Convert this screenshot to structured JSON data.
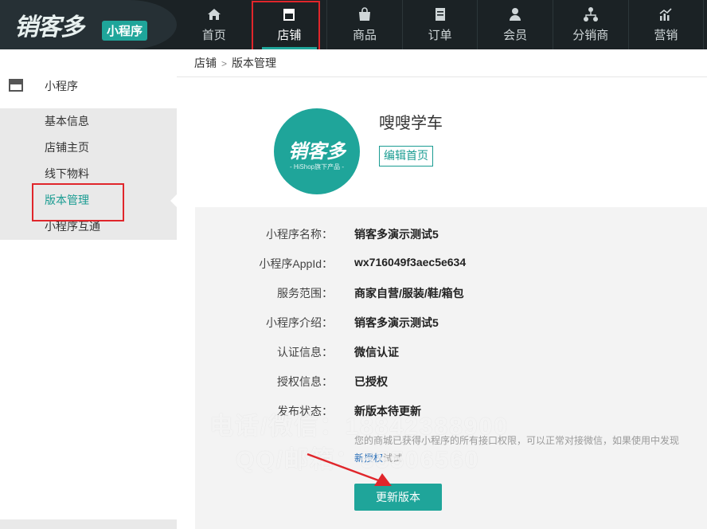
{
  "logo": {
    "main": "销客多",
    "badge": "小程序"
  },
  "nav": [
    {
      "label": "首页",
      "icon": "home-icon"
    },
    {
      "label": "店铺",
      "icon": "store-icon"
    },
    {
      "label": "商品",
      "icon": "bag-icon"
    },
    {
      "label": "订单",
      "icon": "order-icon"
    },
    {
      "label": "会员",
      "icon": "user-icon"
    },
    {
      "label": "分销商",
      "icon": "distributor-icon"
    },
    {
      "label": "营销",
      "icon": "chart-icon"
    }
  ],
  "sidebar": {
    "title": "小程序",
    "items": [
      {
        "label": "基本信息"
      },
      {
        "label": "店铺主页"
      },
      {
        "label": "线下物料"
      },
      {
        "label": "版本管理"
      },
      {
        "label": "小程序互通"
      }
    ]
  },
  "breadcrumb": {
    "root": "店铺",
    "current": "版本管理"
  },
  "shop": {
    "name": "嗖嗖学车",
    "edit_label": "编辑首页",
    "avatar_text": "销客多",
    "avatar_sub": "- HiShop旗下产品 -"
  },
  "info": [
    {
      "key": "小程序名称：",
      "value": "销客多演示测试5"
    },
    {
      "key": "小程序AppId：",
      "value": "wx716049f3aec5e634"
    },
    {
      "key": "服务范围：",
      "value": "商家自营/服装/鞋/箱包"
    },
    {
      "key": "小程序介绍：",
      "value": "销客多演示测试5"
    },
    {
      "key": "认证信息：",
      "value": "微信认证"
    },
    {
      "key": "授权信息：",
      "value": "已授权"
    },
    {
      "key": "发布状态：",
      "value": "新版本待更新"
    }
  ],
  "note": {
    "line1": "您的商城已获得小程序的所有接口权限，可以正常对接微信，如果使用中发现",
    "link": "新授权",
    "line2_tail": "试试"
  },
  "update_label": "更新版本",
  "watermark": {
    "line1": "电话/微信：18842388900",
    "line2": "QQ/邮箱：55506560"
  },
  "colors": {
    "accent": "#1fa59a",
    "highlight": "#e0262b",
    "topbar": "#1b2225"
  }
}
